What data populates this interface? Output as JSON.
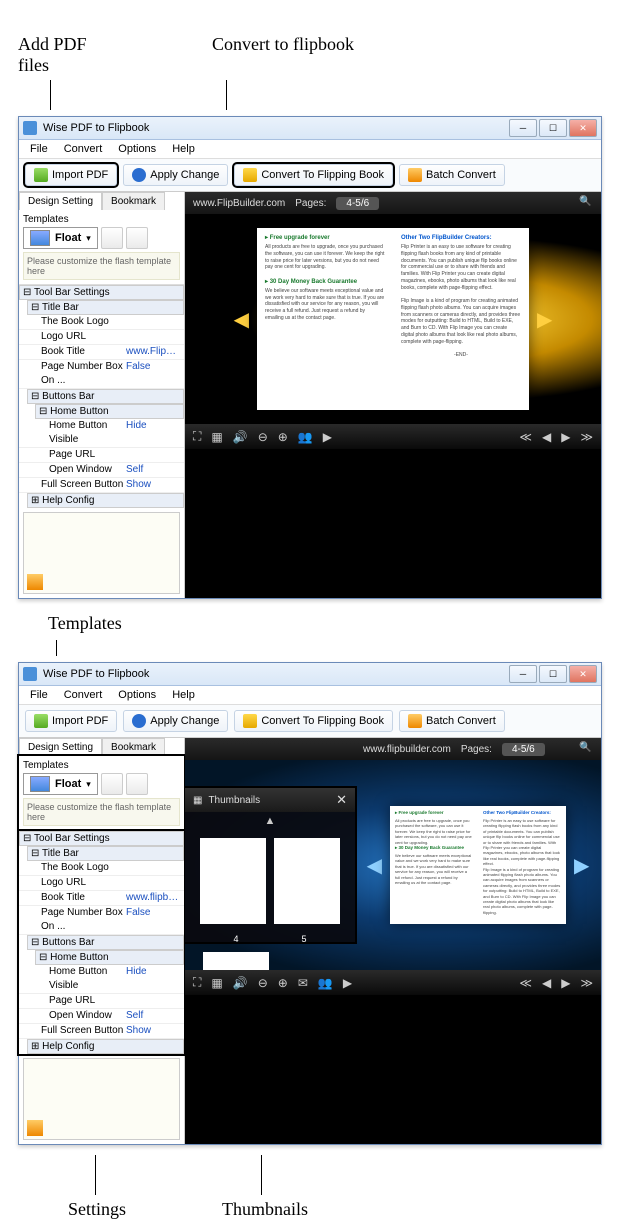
{
  "annotations": {
    "add_pdf": "Add PDF files",
    "convert": "Convert to flipbook",
    "templates": "Templates",
    "settings": "Settings",
    "thumbnails": "Thumbnails"
  },
  "window": {
    "title": "Wise PDF to Flipbook"
  },
  "menu": {
    "file": "File",
    "convert": "Convert",
    "options": "Options",
    "help": "Help"
  },
  "toolbar": {
    "import": "Import PDF",
    "apply": "Apply Change",
    "convert": "Convert To Flipping Book",
    "batch": "Batch Convert"
  },
  "sidebar": {
    "tab1": "Design Setting",
    "tab2": "Bookmark",
    "templates_lbl": "Templates",
    "float": "Float",
    "hint": "Please customize the flash template here",
    "props": {
      "toolbar_hdr": "Tool Bar Settings",
      "titlebar": "Title Bar",
      "book_logo": "The Book Logo",
      "logo_url": "Logo URL",
      "book_title": "Book Title",
      "book_title_v": "www.FlipBuil...",
      "page_num": "Page Number Box On ...",
      "page_num_v": "False",
      "buttons_bar": "Buttons Bar",
      "home_btn": "Home Button",
      "home_vis": "Home Button Visible",
      "home_vis_v": "Hide",
      "page_url": "Page URL",
      "open_win": "Open Window",
      "open_win_v": "Self",
      "full_btn": "Full Screen Button",
      "full_btn_v": "Show",
      "help_cfg": "Help Config",
      "book_title_v2": "www.flipbuil..."
    }
  },
  "preview": {
    "site": "www.FlipBuilder.com",
    "site2": "www.flipbuilder.com",
    "pages_lbl": "Pages:",
    "pages": "4-5/6",
    "left": {
      "h1": "Free upgrade forever",
      "p1": "All products are free to upgrade, once you purchased the software, you can use it forever. We keep the right to raise price for later versions, but you do not need pay one cent for upgrading.",
      "h2": "30 Day Money Back Guarantee",
      "p2": "We believe our software meets exceptional value and we work very hard to make sure that is true. If you are dissatisfied with our service for any reason, you will receive a full refund. Just request a refund by emailing us at the contact page."
    },
    "right": {
      "h1": "Other Two FlipBuilder Creators:",
      "p1": "Flip Printer is an easy to use software for creating flipping flash books from any kind of printable documents. You can publish unique flip books online for commercial use or to share with friends and families. With Flip Printer you can create digital magazines, ebooks, photo albums that look like real books, complete with page-flipping effect.",
      "p2": "Flip Image is a kind of program for creating animated flipping flash photo albums. You can acquire images from scanners or cameras directly, and provides three modes for outputting: Build to HTML, Build to EXE, and Burn to CD. With Flip Image you can create digital photo albums that look like real photo albums, complete with page-flipping.",
      "end": "-END-"
    },
    "thumbs_title": "Thumbnails"
  }
}
